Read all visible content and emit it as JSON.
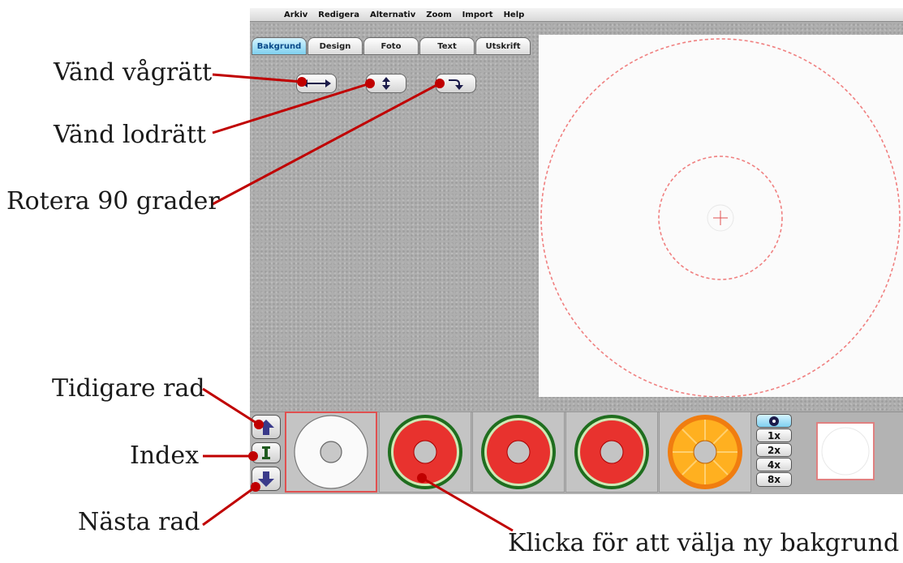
{
  "menu": [
    "Arkiv",
    "Redigera",
    "Alternativ",
    "Zoom",
    "Import",
    "Help"
  ],
  "tabs": [
    {
      "label": "Bakgrund",
      "active": true
    },
    {
      "label": "Design",
      "active": false
    },
    {
      "label": "Foto",
      "active": false
    },
    {
      "label": "Text",
      "active": false
    },
    {
      "label": "Utskrift",
      "active": false
    }
  ],
  "toolbar": {
    "flip_horizontal_icon": "left-right-arrow-icon",
    "flip_vertical_icon": "up-down-arrow-icon",
    "rotate_icon": "rotate-arrow-icon"
  },
  "thumbnails": [
    {
      "type": "plain-disc",
      "selected": true
    },
    {
      "type": "watermelon",
      "selected": false
    },
    {
      "type": "watermelon",
      "selected": false
    },
    {
      "type": "watermelon",
      "selected": false
    },
    {
      "type": "orange",
      "selected": false
    }
  ],
  "zoom": {
    "options": [
      "1x",
      "2x",
      "4x",
      "8x"
    ],
    "selected": "1x"
  },
  "annotations": {
    "flip_horizontal": "Vänd vågrätt",
    "flip_vertical": "Vänd lodrätt",
    "rotate": "Rotera 90 grader",
    "previous_row": "Tidigare rad",
    "index": "Index",
    "next_row": "Nästa rad",
    "select_background": "Klicka för att välja ny bakgrund"
  },
  "colors": {
    "annotation_line": "#c00000",
    "active_tab": "#7fd0ef",
    "guide_dash": "#f08080",
    "nav_arrow": "#3a3a8a",
    "selection": "#e05050"
  }
}
